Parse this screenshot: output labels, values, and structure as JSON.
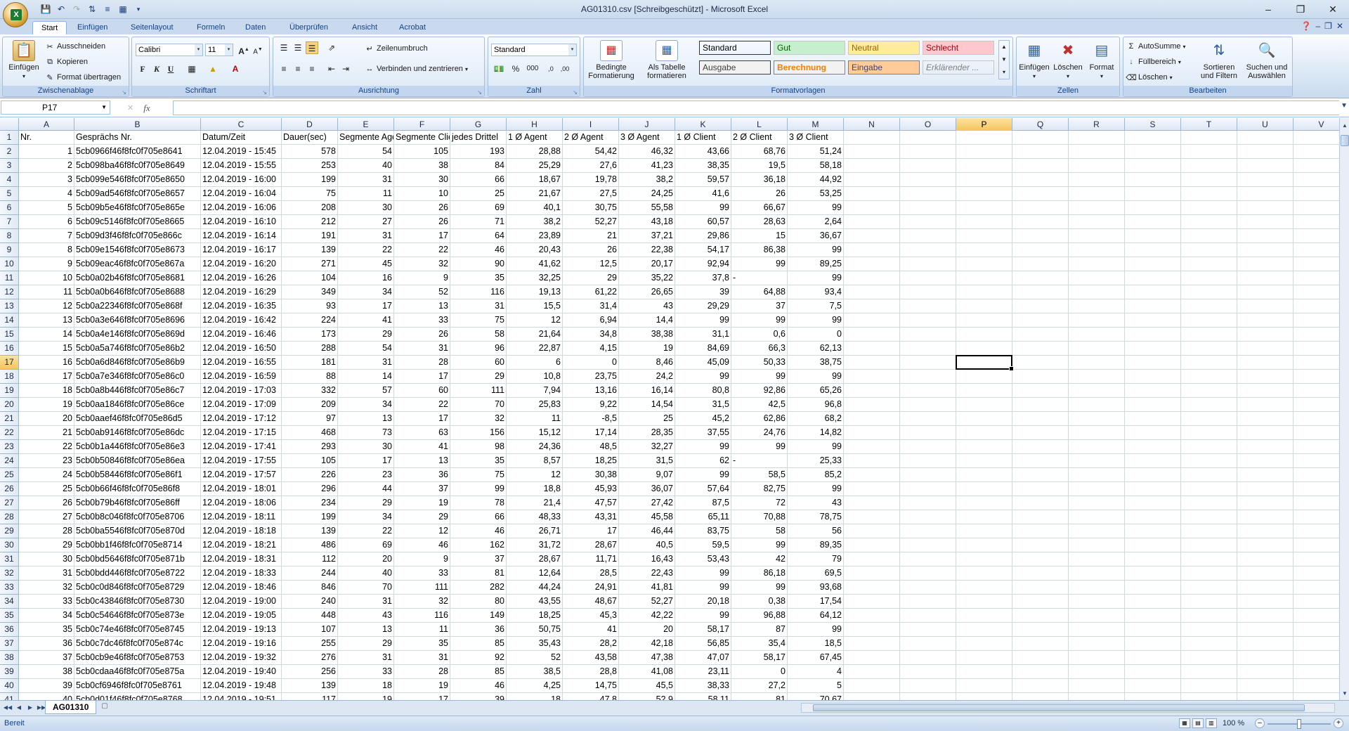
{
  "window": {
    "title": "AG01310.csv  [Schreibgeschützt] - Microsoft Excel"
  },
  "tabs": [
    "Start",
    "Einfügen",
    "Seitenlayout",
    "Formeln",
    "Daten",
    "Überprüfen",
    "Ansicht",
    "Acrobat"
  ],
  "ribbon": {
    "zwischenablage": {
      "label": "Zwischenablage",
      "einfuegen": "Einfügen",
      "ausschneiden": "Ausschneiden",
      "kopieren": "Kopieren",
      "format": "Format übertragen"
    },
    "schriftart": {
      "label": "Schriftart",
      "font": "Calibri",
      "size": "11",
      "bold": "F",
      "italic": "K",
      "underline": "U"
    },
    "ausrichtung": {
      "label": "Ausrichtung",
      "zeilenumbruch": "Zeilenumbruch",
      "verbinden": "Verbinden und zentrieren"
    },
    "zahl": {
      "label": "Zahl",
      "format": "Standard",
      "percent": "%",
      "thousand": "000"
    },
    "formatvorlagen": {
      "label": "Formatvorlagen",
      "bedingte": "Bedingte Formatierung",
      "tabelle": "Als Tabelle formatieren",
      "styles": [
        {
          "name": "Standard",
          "bg": "#ffffff",
          "fg": "#000000"
        },
        {
          "name": "Gut",
          "bg": "#c6efce",
          "fg": "#006100"
        },
        {
          "name": "Neutral",
          "bg": "#ffeb9c",
          "fg": "#9c6500"
        },
        {
          "name": "Schlecht",
          "bg": "#ffc7ce",
          "fg": "#9c0006"
        },
        {
          "name": "Ausgabe",
          "bg": "#f2f2f2",
          "fg": "#3f3f3f"
        },
        {
          "name": "Berechnung",
          "bg": "#f2f2f2",
          "fg": "#fa7d00"
        },
        {
          "name": "Eingabe",
          "bg": "#ffcc99",
          "fg": "#3f3f76"
        },
        {
          "name": "Erklärender ...",
          "bg": "#ffffff",
          "fg": "#7f7f7f"
        }
      ]
    },
    "zellen": {
      "label": "Zellen",
      "einfuegen": "Einfügen",
      "loeschen": "Löschen",
      "format": "Format"
    },
    "bearbeiten": {
      "label": "Bearbeiten",
      "autosumme": "AutoSumme",
      "fuellbereich": "Füllbereich",
      "loeschen": "Löschen",
      "sortieren": "Sortieren und Filtern",
      "suchen": "Suchen und Auswählen"
    }
  },
  "formula": {
    "namebox": "P17",
    "fx": "fx",
    "value": ""
  },
  "columns": [
    "A",
    "B",
    "C",
    "D",
    "E",
    "F",
    "G",
    "H",
    "I",
    "J",
    "K",
    "L",
    "M",
    "N",
    "O",
    "P",
    "Q",
    "R",
    "S",
    "T",
    "U",
    "V"
  ],
  "selected": {
    "column": "P",
    "row": "17"
  },
  "headers": [
    "Nr.",
    "Gesprächs Nr.",
    "Datum/Zeit",
    "Dauer(sec)",
    "Segmente Agent",
    "Segmente Client",
    "jedes Drittel",
    "1 Ø Agent",
    "2 Ø Agent",
    "3 Ø Agent",
    "1 Ø Client",
    "2 Ø Client",
    "3 Ø Client"
  ],
  "rows": [
    [
      "1",
      "5cb0966f46f8fc0f705e8641",
      "12.04.2019 - 15:45",
      "578",
      "54",
      "105",
      "193",
      "28,88",
      "54,42",
      "46,32",
      "43,66",
      "68,76",
      "51,24"
    ],
    [
      "2",
      "5cb098ba46f8fc0f705e8649",
      "12.04.2019 - 15:55",
      "253",
      "40",
      "38",
      "84",
      "25,29",
      "27,6",
      "41,23",
      "38,35",
      "19,5",
      "58,18"
    ],
    [
      "3",
      "5cb099e546f8fc0f705e8650",
      "12.04.2019 - 16:00",
      "199",
      "31",
      "30",
      "66",
      "18,67",
      "19,78",
      "38,2",
      "59,57",
      "36,18",
      "44,92"
    ],
    [
      "4",
      "5cb09ad546f8fc0f705e8657",
      "12.04.2019 - 16:04",
      "75",
      "11",
      "10",
      "25",
      "21,67",
      "27,5",
      "24,25",
      "41,6",
      "26",
      "53,25"
    ],
    [
      "5",
      "5cb09b5e46f8fc0f705e865e",
      "12.04.2019 - 16:06",
      "208",
      "30",
      "26",
      "69",
      "40,1",
      "30,75",
      "55,58",
      "99",
      "66,67",
      "99"
    ],
    [
      "6",
      "5cb09c5146f8fc0f705e8665",
      "12.04.2019 - 16:10",
      "212",
      "27",
      "26",
      "71",
      "38,2",
      "52,27",
      "43,18",
      "60,57",
      "28,63",
      "2,64"
    ],
    [
      "7",
      "5cb09d3f46f8fc0f705e866c",
      "12.04.2019 - 16:14",
      "191",
      "31",
      "17",
      "64",
      "23,89",
      "21",
      "37,21",
      "29,86",
      "15",
      "36,67"
    ],
    [
      "8",
      "5cb09e1546f8fc0f705e8673",
      "12.04.2019 - 16:17",
      "139",
      "22",
      "22",
      "46",
      "20,43",
      "26",
      "22,38",
      "54,17",
      "86,38",
      "99"
    ],
    [
      "9",
      "5cb09eac46f8fc0f705e867a",
      "12.04.2019 - 16:20",
      "271",
      "45",
      "32",
      "90",
      "41,62",
      "12,5",
      "20,17",
      "92,94",
      "99",
      "89,25"
    ],
    [
      "10",
      "5cb0a02b46f8fc0f705e8681",
      "12.04.2019 - 16:26",
      "104",
      "16",
      "9",
      "35",
      "32,25",
      "29",
      "35,22",
      "37,8",
      "-",
      "99"
    ],
    [
      "11",
      "5cb0a0b646f8fc0f705e8688",
      "12.04.2019 - 16:29",
      "349",
      "34",
      "52",
      "116",
      "19,13",
      "61,22",
      "26,65",
      "39",
      "64,88",
      "93,4"
    ],
    [
      "12",
      "5cb0a22346f8fc0f705e868f",
      "12.04.2019 - 16:35",
      "93",
      "17",
      "13",
      "31",
      "15,5",
      "31,4",
      "43",
      "29,29",
      "37",
      "7,5"
    ],
    [
      "13",
      "5cb0a3e646f8fc0f705e8696",
      "12.04.2019 - 16:42",
      "224",
      "41",
      "33",
      "75",
      "12",
      "6,94",
      "14,4",
      "99",
      "99",
      "99"
    ],
    [
      "14",
      "5cb0a4e146f8fc0f705e869d",
      "12.04.2019 - 16:46",
      "173",
      "29",
      "26",
      "58",
      "21,64",
      "34,8",
      "38,38",
      "31,1",
      "0,6",
      "0"
    ],
    [
      "15",
      "5cb0a5a746f8fc0f705e86b2",
      "12.04.2019 - 16:50",
      "288",
      "54",
      "31",
      "96",
      "22,87",
      "4,15",
      "19",
      "84,69",
      "66,3",
      "62,13"
    ],
    [
      "16",
      "5cb0a6d846f8fc0f705e86b9",
      "12.04.2019 - 16:55",
      "181",
      "31",
      "28",
      "60",
      "6",
      "0",
      "8,46",
      "45,09",
      "50,33",
      "38,75"
    ],
    [
      "17",
      "5cb0a7e346f8fc0f705e86c0",
      "12.04.2019 - 16:59",
      "88",
      "14",
      "17",
      "29",
      "10,8",
      "23,75",
      "24,2",
      "99",
      "99",
      "99"
    ],
    [
      "18",
      "5cb0a8b446f8fc0f705e86c7",
      "12.04.2019 - 17:03",
      "332",
      "57",
      "60",
      "111",
      "7,94",
      "13,16",
      "16,14",
      "80,8",
      "92,86",
      "65,26"
    ],
    [
      "19",
      "5cb0aa1846f8fc0f705e86ce",
      "12.04.2019 - 17:09",
      "209",
      "34",
      "22",
      "70",
      "25,83",
      "9,22",
      "14,54",
      "31,5",
      "42,5",
      "96,8"
    ],
    [
      "20",
      "5cb0aaef46f8fc0f705e86d5",
      "12.04.2019 - 17:12",
      "97",
      "13",
      "17",
      "32",
      "11",
      "-8,5",
      "25",
      "45,2",
      "62,86",
      "68,2"
    ],
    [
      "21",
      "5cb0ab9146f8fc0f705e86dc",
      "12.04.2019 - 17:15",
      "468",
      "73",
      "63",
      "156",
      "15,12",
      "17,14",
      "28,35",
      "37,55",
      "24,76",
      "14,82"
    ],
    [
      "22",
      "5cb0b1a446f8fc0f705e86e3",
      "12.04.2019 - 17:41",
      "293",
      "30",
      "41",
      "98",
      "24,36",
      "48,5",
      "32,27",
      "99",
      "99",
      "99"
    ],
    [
      "23",
      "5cb0b50846f8fc0f705e86ea",
      "12.04.2019 - 17:55",
      "105",
      "17",
      "13",
      "35",
      "8,57",
      "18,25",
      "31,5",
      "62",
      "-",
      "25,33"
    ],
    [
      "24",
      "5cb0b58446f8fc0f705e86f1",
      "12.04.2019 - 17:57",
      "226",
      "23",
      "36",
      "75",
      "12",
      "30,38",
      "9,07",
      "99",
      "58,5",
      "85,2"
    ],
    [
      "25",
      "5cb0b66f46f8fc0f705e86f8",
      "12.04.2019 - 18:01",
      "296",
      "44",
      "37",
      "99",
      "18,8",
      "45,93",
      "36,07",
      "57,64",
      "82,75",
      "99"
    ],
    [
      "26",
      "5cb0b79b46f8fc0f705e86ff",
      "12.04.2019 - 18:06",
      "234",
      "29",
      "19",
      "78",
      "21,4",
      "47,57",
      "27,42",
      "87,5",
      "72",
      "43"
    ],
    [
      "27",
      "5cb0b8c046f8fc0f705e8706",
      "12.04.2019 - 18:11",
      "199",
      "34",
      "29",
      "66",
      "48,33",
      "43,31",
      "45,58",
      "65,11",
      "70,88",
      "78,75"
    ],
    [
      "28",
      "5cb0ba5546f8fc0f705e870d",
      "12.04.2019 - 18:18",
      "139",
      "22",
      "12",
      "46",
      "26,71",
      "17",
      "46,44",
      "83,75",
      "58",
      "56"
    ],
    [
      "29",
      "5cb0bb1f46f8fc0f705e8714",
      "12.04.2019 - 18:21",
      "486",
      "69",
      "46",
      "162",
      "31,72",
      "28,67",
      "40,5",
      "59,5",
      "99",
      "89,35"
    ],
    [
      "30",
      "5cb0bd5646f8fc0f705e871b",
      "12.04.2019 - 18:31",
      "112",
      "20",
      "9",
      "37",
      "28,67",
      "11,71",
      "16,43",
      "53,43",
      "42",
      "79"
    ],
    [
      "31",
      "5cb0bdd446f8fc0f705e8722",
      "12.04.2019 - 18:33",
      "244",
      "40",
      "33",
      "81",
      "12,64",
      "28,5",
      "22,43",
      "99",
      "86,18",
      "69,5"
    ],
    [
      "32",
      "5cb0c0d846f8fc0f705e8729",
      "12.04.2019 - 18:46",
      "846",
      "70",
      "111",
      "282",
      "44,24",
      "24,91",
      "41,81",
      "99",
      "99",
      "93,68"
    ],
    [
      "33",
      "5cb0c43846f8fc0f705e8730",
      "12.04.2019 - 19:00",
      "240",
      "31",
      "32",
      "80",
      "43,55",
      "48,67",
      "52,27",
      "20,18",
      "0,38",
      "17,54"
    ],
    [
      "34",
      "5cb0c54646f8fc0f705e873e",
      "12.04.2019 - 19:05",
      "448",
      "43",
      "116",
      "149",
      "18,25",
      "45,3",
      "42,22",
      "99",
      "96,88",
      "64,12"
    ],
    [
      "35",
      "5cb0c74e46f8fc0f705e8745",
      "12.04.2019 - 19:13",
      "107",
      "13",
      "11",
      "36",
      "50,75",
      "41",
      "20",
      "58,17",
      "87",
      "99"
    ],
    [
      "36",
      "5cb0c7dc46f8fc0f705e874c",
      "12.04.2019 - 19:16",
      "255",
      "29",
      "35",
      "85",
      "35,43",
      "28,2",
      "42,18",
      "56,85",
      "35,4",
      "18,5"
    ],
    [
      "37",
      "5cb0cb9e46f8fc0f705e8753",
      "12.04.2019 - 19:32",
      "276",
      "31",
      "31",
      "92",
      "52",
      "43,58",
      "47,38",
      "47,07",
      "58,17",
      "67,45"
    ],
    [
      "38",
      "5cb0cdaa46f8fc0f705e875a",
      "12.04.2019 - 19:40",
      "256",
      "33",
      "28",
      "85",
      "38,5",
      "28,8",
      "41,08",
      "23,11",
      "0",
      "4"
    ],
    [
      "39",
      "5cb0cf6946f8fc0f705e8761",
      "12.04.2019 - 19:48",
      "139",
      "18",
      "19",
      "46",
      "4,25",
      "14,75",
      "45,5",
      "38,33",
      "27,2",
      "5"
    ],
    [
      "40",
      "5cb0d01f46f8fc0f705e8768",
      "12.04.2019 - 19:51",
      "117",
      "19",
      "17",
      "39",
      "18",
      "47,8",
      "52,9",
      "58,11",
      "81",
      "70,67"
    ]
  ],
  "sheet": {
    "name": "AG01310"
  },
  "status": {
    "text": "Bereit",
    "zoom": "100 %"
  }
}
